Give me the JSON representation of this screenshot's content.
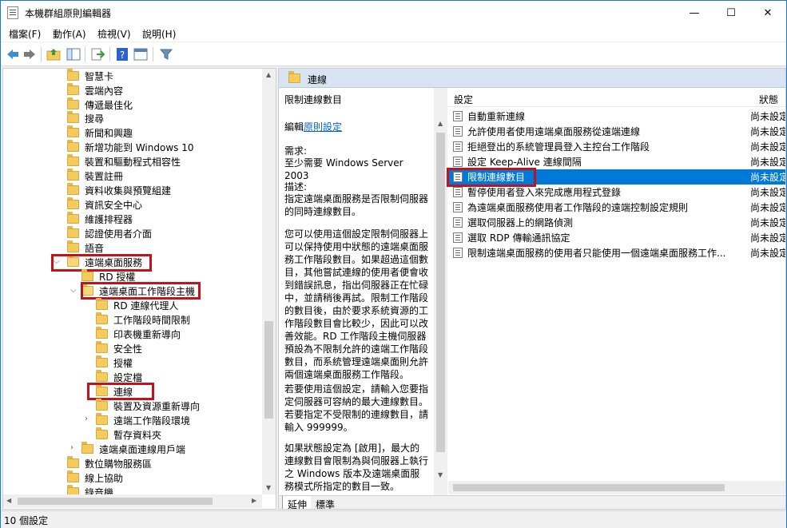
{
  "window": {
    "title": "本機群組原則編輯器",
    "minimize": "—",
    "maximize": "☐",
    "close": "✕"
  },
  "menu": {
    "items": [
      "檔案(F)",
      "動作(A)",
      "檢視(V)",
      "說明(H)"
    ]
  },
  "toolbar": {
    "icons": [
      "back-icon",
      "forward-icon",
      "up-folder-icon",
      "show-hide-tree-icon",
      "export-icon",
      "help-icon",
      "properties-icon",
      "filter-icon"
    ]
  },
  "tree": {
    "items": [
      {
        "label": "智慧卡",
        "level": 1
      },
      {
        "label": "雲端內容",
        "level": 1
      },
      {
        "label": "傳遞最佳化",
        "level": 1
      },
      {
        "label": "搜尋",
        "level": 1
      },
      {
        "label": "新聞和興趣",
        "level": 1
      },
      {
        "label": "新增功能到 Windows 10",
        "level": 1
      },
      {
        "label": "裝置和驅動程式相容性",
        "level": 1
      },
      {
        "label": "裝置註冊",
        "level": 1
      },
      {
        "label": "資料收集與預覽組建",
        "level": 1
      },
      {
        "label": "資訊安全中心",
        "level": 1
      },
      {
        "label": "維護排程器",
        "level": 1
      },
      {
        "label": "認證使用者介面",
        "level": 1
      },
      {
        "label": "語音",
        "level": 1
      },
      {
        "label": "遠端桌面服務",
        "level": 1
      },
      {
        "label": "RD 授權",
        "level": 2
      },
      {
        "label": "遠端桌面工作階段主機",
        "level": 2
      },
      {
        "label": "RD 連線代理人",
        "level": 3
      },
      {
        "label": "工作階段時間限制",
        "level": 3
      },
      {
        "label": "印表機重新導向",
        "level": 3
      },
      {
        "label": "安全性",
        "level": 3
      },
      {
        "label": "授權",
        "level": 3
      },
      {
        "label": "設定檔",
        "level": 3
      },
      {
        "label": "連線",
        "level": 3
      },
      {
        "label": "裝置及資源重新導向",
        "level": 3
      },
      {
        "label": "遠端工作階段環境",
        "level": 3
      },
      {
        "label": "暫存資料夾",
        "level": 3
      },
      {
        "label": "遠端桌面連線用戶端",
        "level": 2
      },
      {
        "label": "數位購物服務區",
        "level": 1
      },
      {
        "label": "線上協助",
        "level": 1
      },
      {
        "label": "錄音機",
        "level": 1
      }
    ]
  },
  "right_pane": {
    "header_title": "連線",
    "desc_title": "限制連線數目",
    "edit_prefix": "編輯",
    "edit_link": "原則設定",
    "requirement_label": "需求:",
    "requirement_value": "至少需要 Windows Server 2003",
    "description_label": "描述:",
    "description_1": "指定遠端桌面服務是否限制伺服器的同時連線數目。",
    "description_2": "您可以使用這個設定限制伺服器上可以保持使用中狀態的遠端桌面服務工作階段數目。如果超過這個數目，其他嘗試連線的使用者便會收到錯誤訊息，指出伺服器正在忙碌中，並請稍後再試。限制工作階段的數目後，由於要求系統資源的工作階段數目會比較少，因此可以改善效能。RD 工作階段主機伺服器預設為不限制允許的遠端工作階段數目，而系統管理遠端桌面則允許兩個遠端桌面服務工作階段。",
    "description_3": "若要使用這個設定，請輸入您要指定伺服器可容納的最大連線數目。若要指定不受限制的連線數目，請輸入 999999。",
    "description_4": "如果狀態設定為 [啟用]，最大的連線數目會限制為與伺服器上執行之 Windows 版本及遠端桌面服務模式所指定的數目一致。",
    "columns": {
      "setting": "設定",
      "state": "狀態"
    },
    "rows": [
      {
        "name": "自動重新連線",
        "state": "尚未設定"
      },
      {
        "name": "允許使用者使用遠端桌面服務從遠端連線",
        "state": "尚未設定"
      },
      {
        "name": "拒絕登出的系統管理員登入主控台工作階段",
        "state": "尚未設定"
      },
      {
        "name": "設定 Keep-Alive 連線間隔",
        "state": "尚未設定"
      },
      {
        "name": "限制連線數目",
        "state": "尚未設定"
      },
      {
        "name": "暫停使用者登入來完成應用程式登錄",
        "state": "尚未設定"
      },
      {
        "name": "為遠端桌面服務使用者工作階段的遠端控制設定規則",
        "state": "尚未設定"
      },
      {
        "name": "選取伺服器上的網路偵測",
        "state": "尚未設定"
      },
      {
        "name": "選取 RDP 傳輸通訊協定",
        "state": "尚未設定"
      },
      {
        "name": "限制遠端桌面服務的使用者只能使用一個遠端桌面服務工作...",
        "state": "尚未設定"
      }
    ],
    "tabs": [
      "延伸",
      "標準"
    ]
  },
  "status": {
    "text": "10 個設定"
  }
}
